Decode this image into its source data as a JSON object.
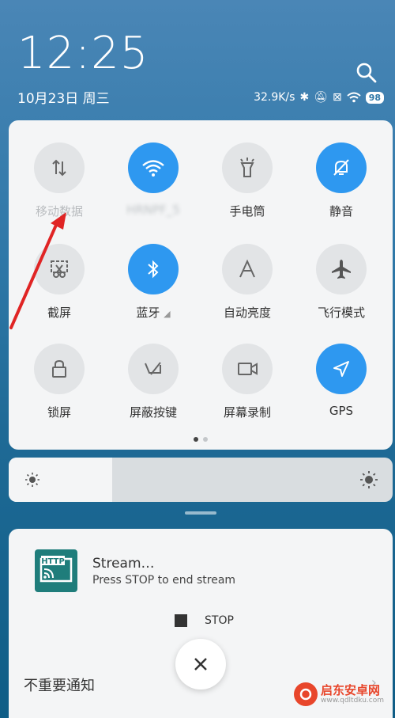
{
  "status": {
    "time": "12:25",
    "date": "10月23日 周三",
    "net_speed": "32.9K/s",
    "battery": "98"
  },
  "quick_settings": {
    "tiles": [
      {
        "id": "mobile-data",
        "label": "移动数据",
        "icon": "data-arrows-icon",
        "on": false
      },
      {
        "id": "wifi",
        "label": "",
        "icon": "wifi-icon",
        "on": true
      },
      {
        "id": "flashlight",
        "label": "手电筒",
        "icon": "flashlight-icon",
        "on": false
      },
      {
        "id": "mute",
        "label": "静音",
        "icon": "bell-off-icon",
        "on": true
      },
      {
        "id": "screenshot",
        "label": "截屏",
        "icon": "scissors-icon",
        "on": false
      },
      {
        "id": "bluetooth",
        "label": "蓝牙",
        "icon": "bluetooth-icon",
        "on": true
      },
      {
        "id": "auto-brightness",
        "label": "自动亮度",
        "icon": "letter-a-icon",
        "on": false
      },
      {
        "id": "airplane",
        "label": "飞行模式",
        "icon": "airplane-icon",
        "on": false
      },
      {
        "id": "lock",
        "label": "锁屏",
        "icon": "lock-icon",
        "on": false
      },
      {
        "id": "block-keys",
        "label": "屏蔽按键",
        "icon": "block-keys-icon",
        "on": false
      },
      {
        "id": "screen-record",
        "label": "屏幕录制",
        "icon": "video-camera-icon",
        "on": false
      },
      {
        "id": "gps",
        "label": "GPS",
        "icon": "navigation-icon",
        "on": true
      }
    ],
    "page_index": 1,
    "page_count": 2
  },
  "brightness": {
    "level": 0.27
  },
  "notification": {
    "app_icon_text": "HTTP",
    "title": "Stream…",
    "body": "Press STOP to end stream",
    "stop_label": "STOP"
  },
  "unimportant_label": "不重要通知",
  "watermark": {
    "name": "启东安卓网",
    "url": "www.qdltdku.com"
  },
  "colors": {
    "accent": "#2e98f0",
    "arrow": "#e02424"
  }
}
